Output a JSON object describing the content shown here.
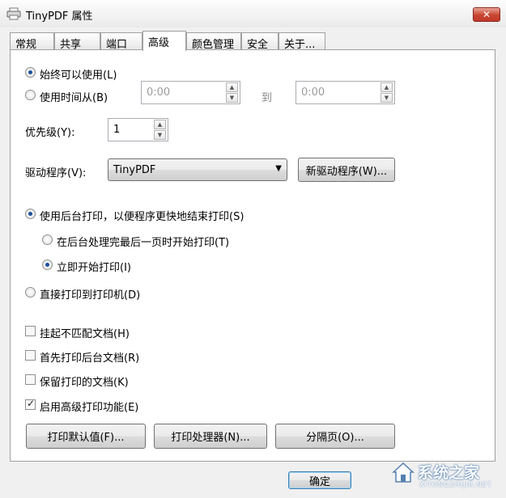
{
  "window": {
    "title": "TinyPDF 属性",
    "close_label": "✕"
  },
  "tabs": [
    {
      "label": "常规"
    },
    {
      "label": "共享"
    },
    {
      "label": "端口"
    },
    {
      "label": "高级",
      "active": true
    },
    {
      "label": "颜色管理"
    },
    {
      "label": "安全"
    },
    {
      "label": "关于..."
    }
  ],
  "availability": {
    "always_label": "始终可以使用(L)",
    "always_selected": true,
    "from_label": "使用时间从(B)",
    "from_value": "0:00",
    "to_label": "到",
    "to_value": "0:00"
  },
  "priority": {
    "label": "优先级(Y):",
    "value": "1"
  },
  "driver": {
    "label": "驱动程序(V):",
    "selected": "TinyPDF",
    "new_driver_button": "新驱动程序(W)..."
  },
  "spooling": {
    "spool_label": "使用后台打印，以便程序更快地结束打印(S)",
    "spool_selected": true,
    "after_last_page_label": "在后台处理完最后一页时开始打印(T)",
    "immediately_label": "立即开始打印(I)",
    "immediately_selected": true,
    "direct_label": "直接打印到打印机(D)"
  },
  "options": [
    {
      "label": "挂起不匹配文档(H)",
      "checked": false
    },
    {
      "label": "首先打印后台文档(R)",
      "checked": false
    },
    {
      "label": "保留打印的文档(K)",
      "checked": false
    },
    {
      "label": "启用高级打印功能(E)",
      "checked": true
    }
  ],
  "bottom_buttons": {
    "defaults": "打印默认值(F)...",
    "processor": "打印处理器(N)...",
    "separator_page": "分隔页(O)..."
  },
  "footer": {
    "ok": "确定"
  },
  "watermark": {
    "text": "系统之家",
    "sub": "XITONGZHIJIA.NET"
  },
  "colors": {
    "close_button": "#c9452f",
    "radio_dot": "#1b4f9c"
  }
}
